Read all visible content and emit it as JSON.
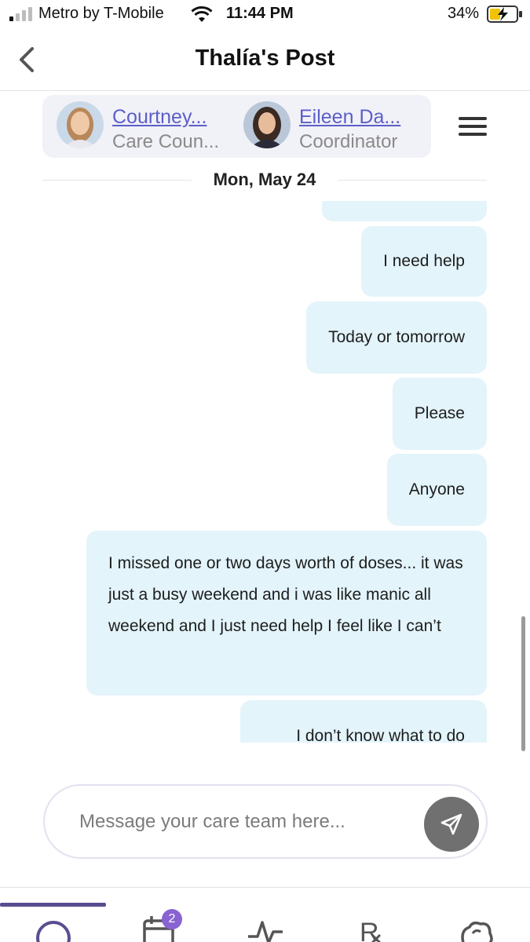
{
  "status_bar": {
    "carrier": "Metro by T-Mobile",
    "time": "11:44 PM",
    "battery": "34%"
  },
  "header": {
    "title": "Thalía's Post",
    "back_icon": "chevron-left-icon"
  },
  "care_team": {
    "members": [
      {
        "name": "Courtney...",
        "role": "Care Coun..."
      },
      {
        "name": "Eileen Da...",
        "role": "Coordinator"
      }
    ],
    "menu_icon": "hamburger-menu-icon"
  },
  "date_divider": "Mon, May 24",
  "messages": [
    {
      "text": "I need help"
    },
    {
      "text": "Today or tomorrow"
    },
    {
      "text": "Please"
    },
    {
      "text": "Anyone"
    },
    {
      "text": "I missed one or two days worth of doses... it was just a busy weekend and i was like manic all weekend and I just need help I feel like I can’t"
    },
    {
      "text": "I don’t know what to do"
    }
  ],
  "composer": {
    "placeholder": "Message your care team here...",
    "send_icon": "send-icon"
  },
  "tab_bar": {
    "tabs": [
      {
        "icon": "chat-icon",
        "active": true
      },
      {
        "icon": "calendar-icon",
        "badge": "2"
      },
      {
        "icon": "activity-icon"
      },
      {
        "icon": "prescription-icon"
      },
      {
        "icon": "brain-icon"
      }
    ]
  },
  "colors": {
    "accent": "#5b5fc7",
    "bubble": "#e3f4fb",
    "badge": "#8a63d2",
    "tab_active": "#5a4d8f"
  }
}
